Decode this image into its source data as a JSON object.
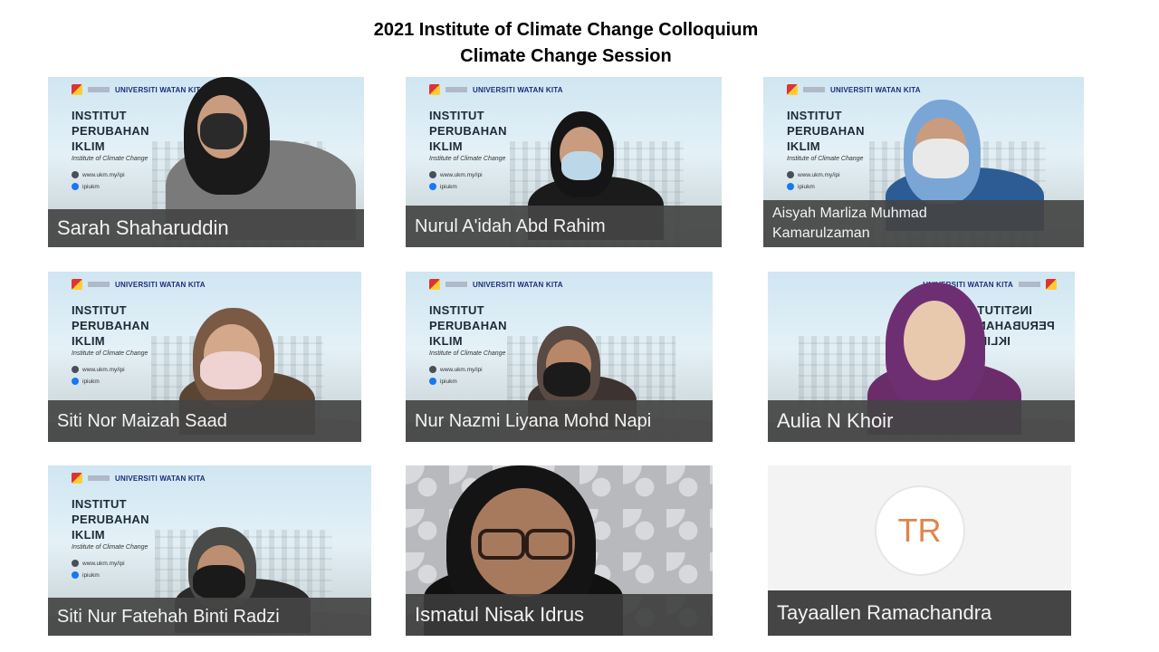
{
  "title_line1": "2021 Institute of Climate Change Colloquium",
  "title_line2": "Climate Change Session",
  "banner": {
    "line1": "INSTITUT",
    "line2": "PERUBAHAN",
    "line3": "IKLIM",
    "subtitle": "Institute of Climate Change",
    "website": "www.ukm.my/ipi",
    "social": "ipiukm",
    "university": "UNIVERSITI WATAN KITA"
  },
  "participants": [
    {
      "name": "Sarah Shaharuddin"
    },
    {
      "name": "Nurul A'idah Abd Rahim"
    },
    {
      "name": "Aisyah Marliza Muhmad Kamarulzaman"
    },
    {
      "name": "Siti Nor Maizah Saad"
    },
    {
      "name": "Nur Nazmi Liyana Mohd Napi"
    },
    {
      "name": "Aulia N Khoir"
    },
    {
      "name": "Siti Nur Fatehah Binti Radzi"
    },
    {
      "name": "Ismatul Nisak Idrus"
    },
    {
      "name": "Tayaallen Ramachandra",
      "initials": "TR"
    }
  ],
  "colors": {
    "label_bg": "#444444",
    "avatar_text": "#e0854a",
    "banner_text": "#1e2a38"
  },
  "icons": [
    "web-icon",
    "facebook-icon",
    "university-logo"
  ]
}
